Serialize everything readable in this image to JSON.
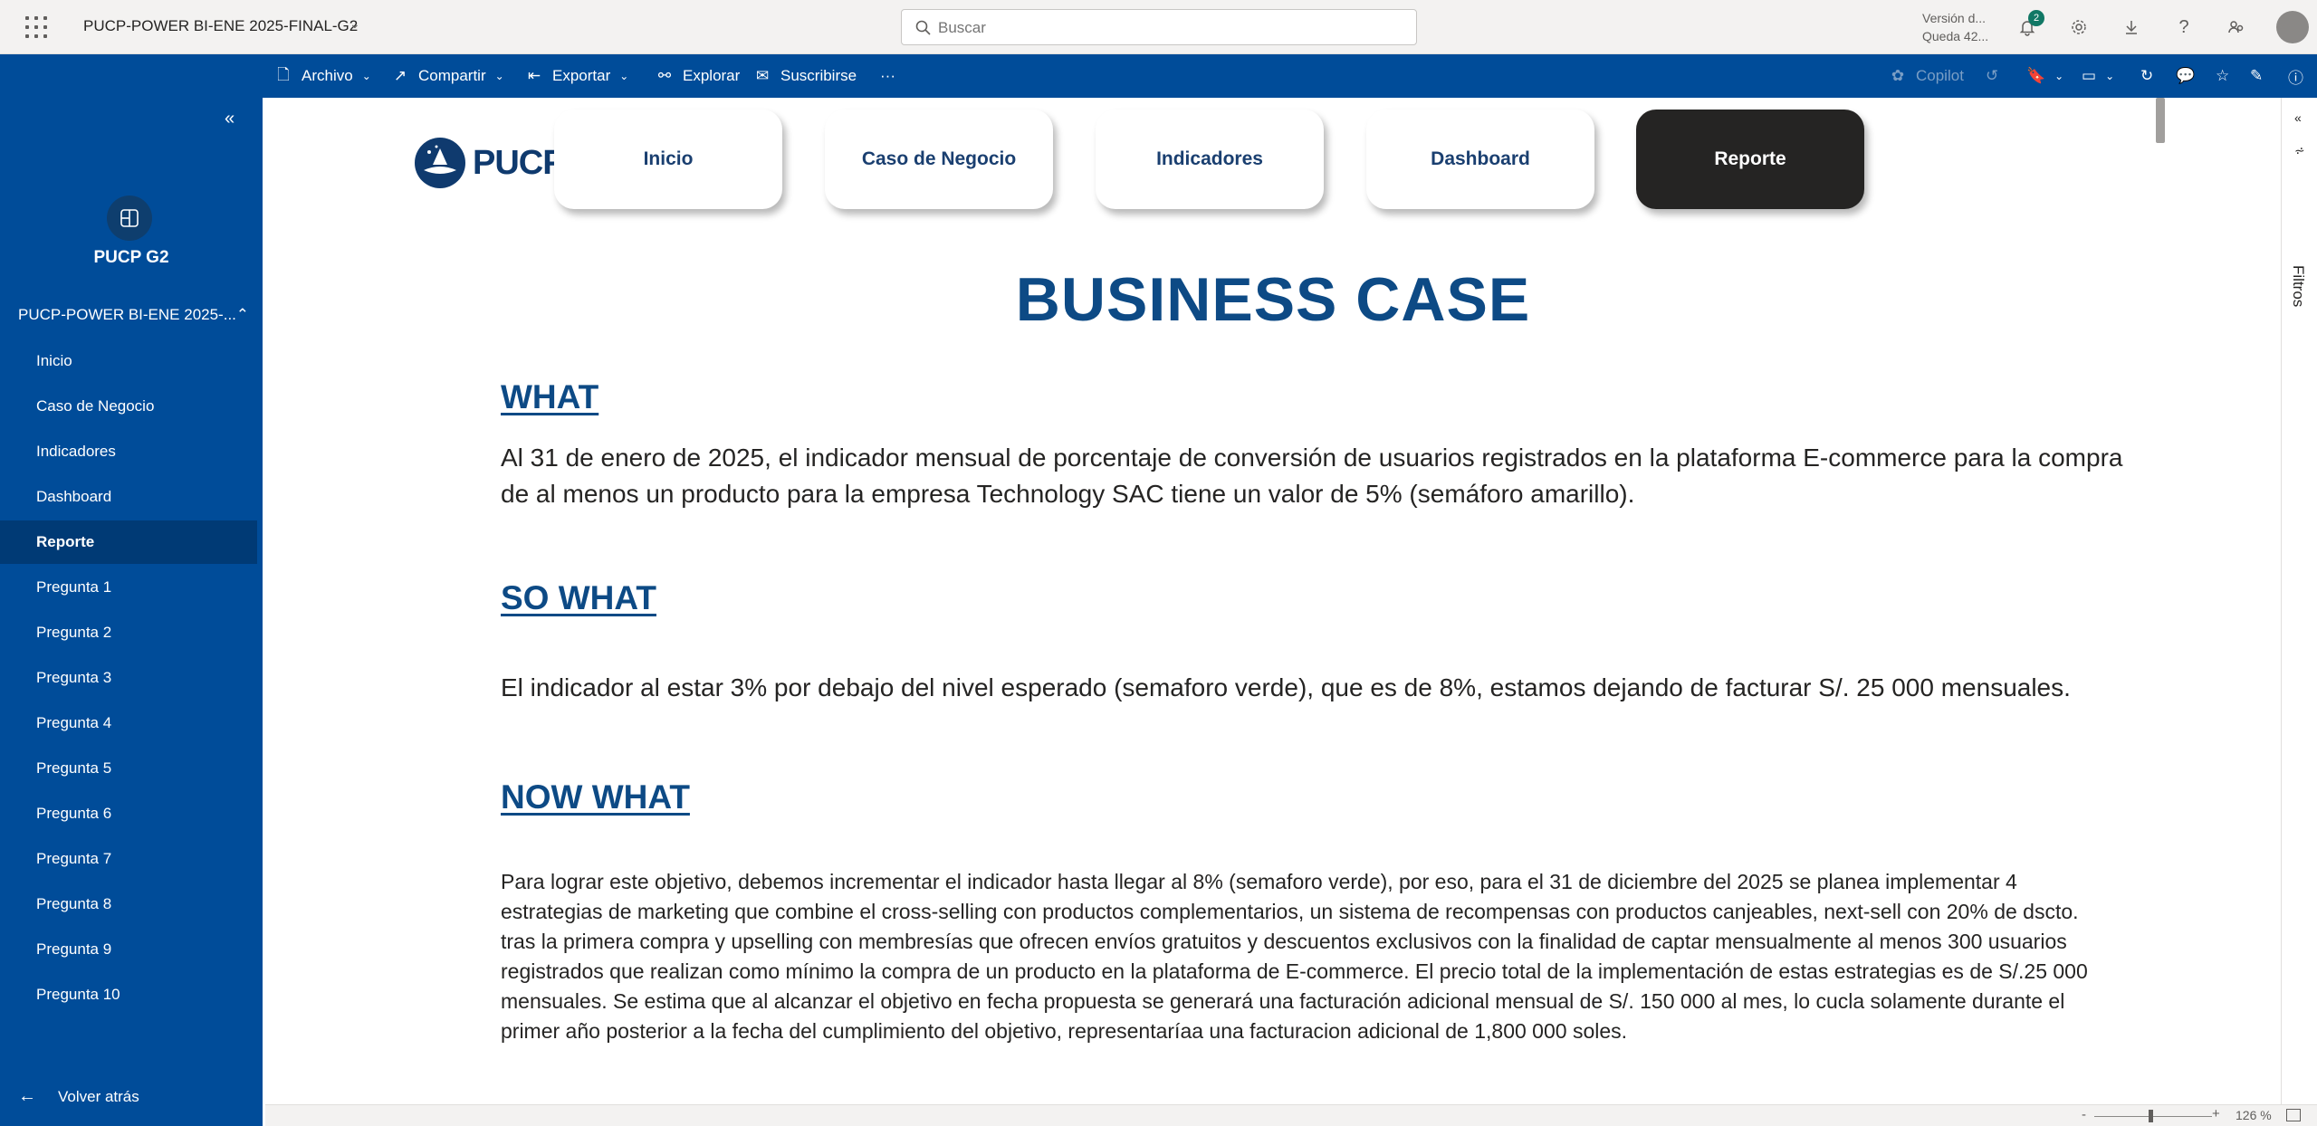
{
  "header": {
    "app_title": "PUCP-POWER BI-ENE 2025-FINAL-G2",
    "search_placeholder": "Buscar",
    "version_line1": "Versión d...",
    "version_line2": "Queda 42...",
    "notification_count": "2"
  },
  "commands": {
    "archivo": "Archivo",
    "compartir": "Compartir",
    "exportar": "Exportar",
    "explorar": "Explorar",
    "suscribirse": "Suscribirse",
    "more": "···",
    "copilot": "Copilot"
  },
  "sidebar": {
    "workspace_name": "PUCP G2",
    "section_title": "PUCP-POWER BI-ENE 2025-...",
    "items": [
      {
        "label": "Inicio"
      },
      {
        "label": "Caso de Negocio"
      },
      {
        "label": "Indicadores"
      },
      {
        "label": "Dashboard"
      },
      {
        "label": "Reporte"
      },
      {
        "label": "Pregunta 1"
      },
      {
        "label": "Pregunta 2"
      },
      {
        "label": "Pregunta 3"
      },
      {
        "label": "Pregunta 4"
      },
      {
        "label": "Pregunta 5"
      },
      {
        "label": "Pregunta 6"
      },
      {
        "label": "Pregunta 7"
      },
      {
        "label": "Pregunta 8"
      },
      {
        "label": "Pregunta 9"
      },
      {
        "label": "Pregunta 10"
      }
    ],
    "active_item": "Reporte",
    "back_label": "Volver atrás"
  },
  "report": {
    "logo_text": "PUCP",
    "nav_buttons": [
      {
        "label": "Inicio"
      },
      {
        "label": "Caso de Negocio"
      },
      {
        "label": "Indicadores"
      },
      {
        "label": "Dashboard"
      },
      {
        "label": "Reporte"
      }
    ],
    "title": "BUSINESS CASE",
    "what_heading": "WHAT",
    "what_text": "Al 31 de enero de 2025, el indicador mensual de porcentaje de conversión de usuarios registrados en la plataforma E-commerce para la compra de al menos un producto para la empresa Technology SAC tiene un valor de 5% (semáforo amarillo).",
    "so_what_heading": "SO WHAT",
    "so_what_text": "El indicador al estar 3% por debajo del nivel esperado (semaforo verde), que es de 8%, estamos dejando de facturar S/. 25 000 mensuales.",
    "now_what_heading": "NOW WHAT",
    "now_what_text": "Para lograr este objetivo, debemos incrementar el indicador hasta llegar al 8% (semaforo verde), por eso, para el 31 de diciembre del 2025 se planea implementar 4 estrategias de marketing que combine el cross-selling con productos complementarios, un sistema de recompensas con productos canjeables, next-sell con 20% de dscto. tras la primera compra y upselling con membresías que ofrecen envíos gratuitos y descuentos exclusivos con la finalidad de captar mensualmente al menos 300 usuarios registrados que realizan como mínimo la compra de un producto en la plataforma de E-commerce. El precio total de la implementación de estas estrategias es de S/.25 000 mensuales. Se estima que al alcanzar el objetivo en fecha propuesta se generará una facturación adicional mensual de S/. 150 000 al mes, lo cucla solamente durante el primer año posterior a la fecha del cumplimiento del objetivo, representaríaa una facturacion adicional de 1,800 000 soles."
  },
  "filters_pane": {
    "label": "Filtros"
  },
  "statusbar": {
    "zoom_minus": "-",
    "zoom_plus": "+",
    "zoom": "126 %",
    "zoom_level": 0.48
  },
  "colors": {
    "brand_blue": "#004c99",
    "title_blue": "#0d4a85",
    "active_nav": "#252423",
    "badge": "#117865"
  }
}
